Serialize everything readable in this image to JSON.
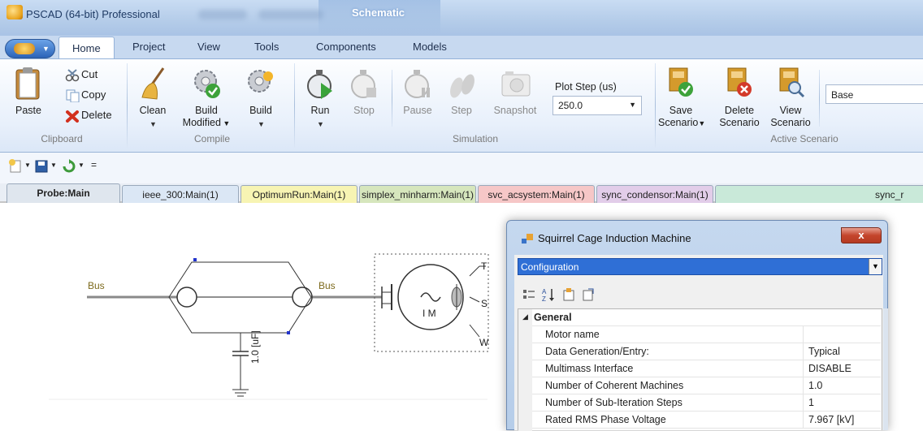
{
  "titlebar": {
    "app_title": "PSCAD (64-bit) Professional",
    "doc_title": "Schematic"
  },
  "ribbon_tabs": [
    "Home",
    "Project",
    "View",
    "Tools",
    "Components",
    "Models"
  ],
  "clipboard": {
    "paste": "Paste",
    "cut": "Cut",
    "copy": "Copy",
    "delete": "Delete",
    "label": "Clipboard"
  },
  "compile": {
    "clean": "Clean",
    "build_modified_1": "Build",
    "build_modified_2": "Modified",
    "build": "Build",
    "label": "Compile"
  },
  "simulation": {
    "run": "Run",
    "stop": "Stop",
    "pause": "Pause",
    "step": "Step",
    "snapshot": "Snapshot",
    "plot_step_label": "Plot Step (us)",
    "plot_step_value": "250.0",
    "label": "Simulation"
  },
  "scenario": {
    "save_1": "Save",
    "save_2": "Scenario",
    "delete_1": "Delete",
    "delete_2": "Scenario",
    "view_1": "View",
    "view_2": "Scenario",
    "label": "Active Scenario",
    "current": "Base"
  },
  "doc_tabs": [
    "Probe:Main",
    "ieee_300:Main(1)",
    "OptimumRun:Main(1)",
    "simplex_minharm:Main(1)",
    "svc_acsystem:Main(1)",
    "sync_condensor:Main(1)",
    "sync_r"
  ],
  "schematic": {
    "bus1": "Bus",
    "bus2": "Bus",
    "cap": "1.0 [uF]",
    "im": "I M",
    "t": "T",
    "s": "S",
    "w": "W"
  },
  "dialog": {
    "title": "Squirrel Cage Induction Machine",
    "close": "x",
    "category_select": "Configuration",
    "group": "General",
    "rows": [
      {
        "key": "Motor name",
        "value": ""
      },
      {
        "key": "Data Generation/Entry:",
        "value": "Typical"
      },
      {
        "key": "Multimass Interface",
        "value": "DISABLE"
      },
      {
        "key": "Number of Coherent Machines",
        "value": "1.0"
      },
      {
        "key": "Number of Sub-Iteration Steps",
        "value": "1"
      },
      {
        "key": "Rated RMS Phase Voltage",
        "value": "7.967 [kV]"
      }
    ]
  }
}
